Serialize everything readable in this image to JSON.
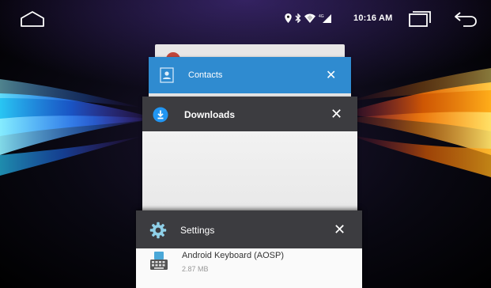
{
  "statusbar": {
    "time": "10:16 AM",
    "icons": [
      "location-icon",
      "bluetooth-icon",
      "wifi-icon",
      "signal-icon"
    ],
    "nav": [
      "home-icon",
      "recents-icon",
      "back-icon"
    ]
  },
  "recent_apps": [
    {
      "title": "",
      "header_color": "#e8e6e6",
      "icon": "app-icon"
    },
    {
      "title": "Contacts",
      "header_color": "#2f8bd0",
      "icon": "contacts-icon"
    },
    {
      "title": "Downloads",
      "header_color": "#3c3c40",
      "icon": "downloads-icon"
    },
    {
      "title": "Settings",
      "header_color": "#3c3c40",
      "icon": "settings-icon",
      "content": {
        "app_name": "Android Keyboard (AOSP)",
        "app_size": "2.87 MB",
        "icon": "keyboard-icon"
      }
    }
  ],
  "close_glyph": "✕",
  "colors": {
    "accent_blue": "#2f8bd0",
    "dark_header": "#3c3c40",
    "downloads_blue": "#2196f3"
  }
}
